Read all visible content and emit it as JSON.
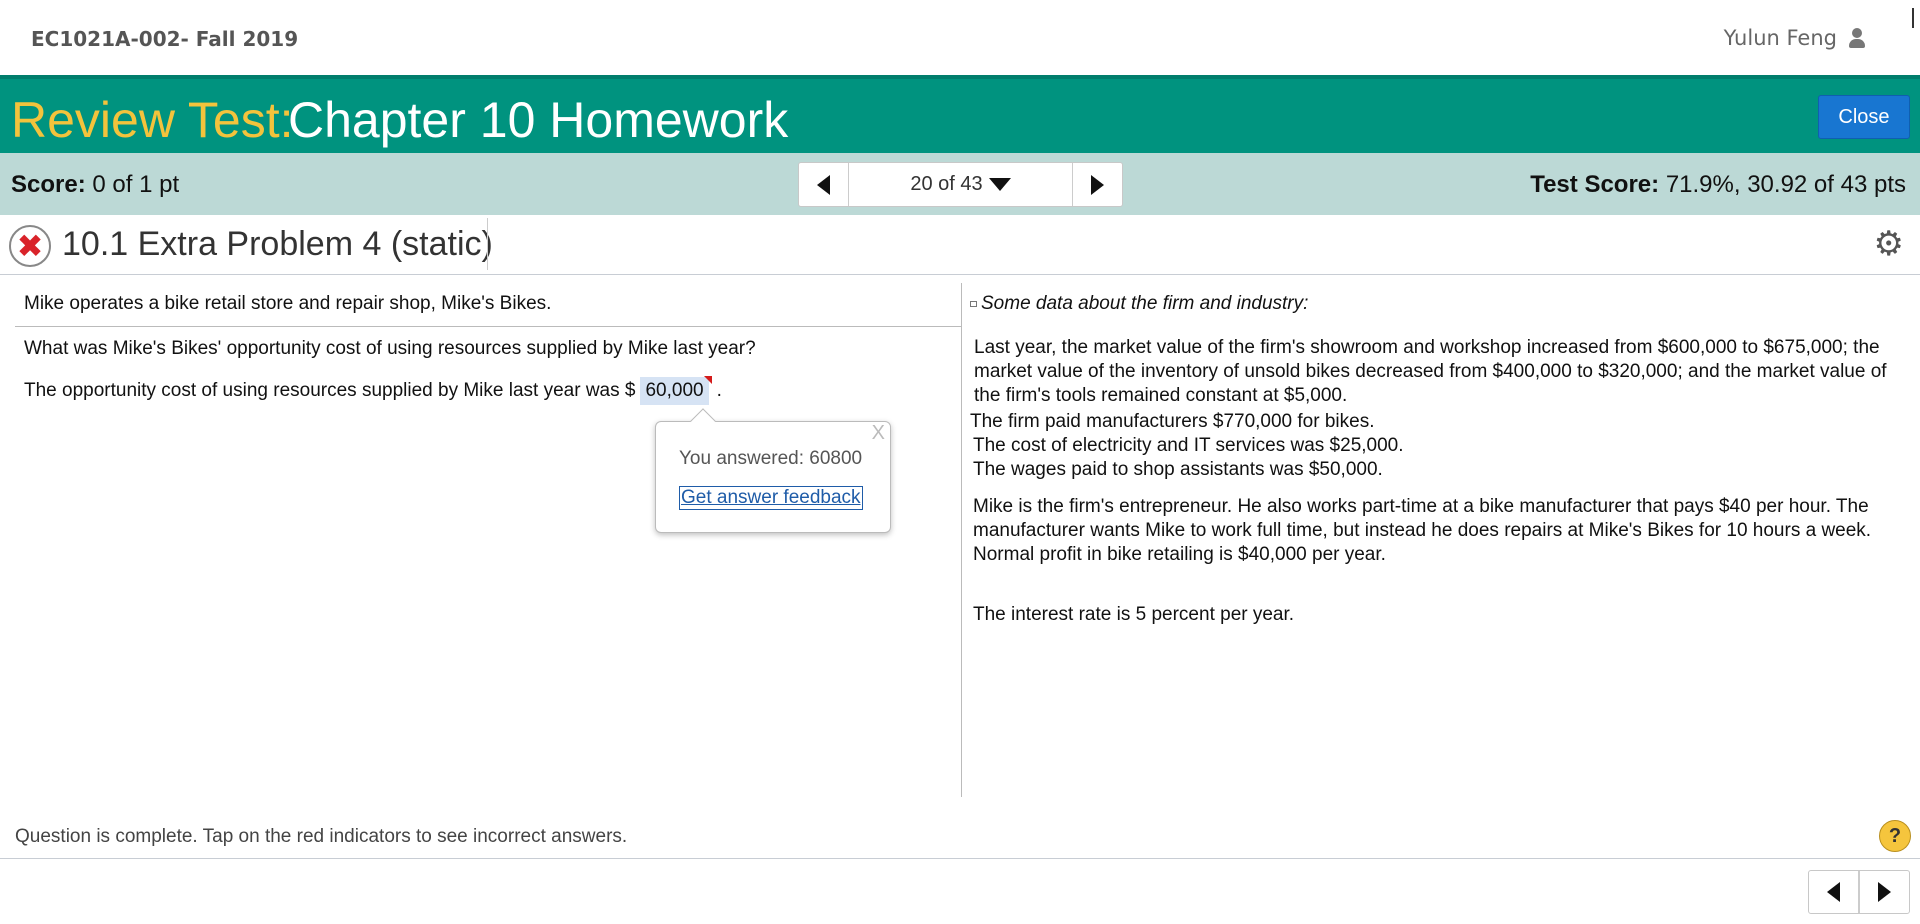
{
  "top": {
    "course": "EC1021A-002- Fall 2019",
    "user_name": "Yulun Feng"
  },
  "header": {
    "title_prefix": "Review Test:",
    "title_main": "Chapter 10 Homework",
    "close_label": "Close"
  },
  "scorebar": {
    "score_label": "Score:",
    "score_value": "0 of 1 pt",
    "pager_text": "20 of 43",
    "test_score_label": "Test Score:",
    "test_score_value": "71.9%, 30.92 of 43 pts"
  },
  "question": {
    "title": "10.1 Extra Problem 4 (static)",
    "intro": "Mike operates a bike retail store and repair shop, Mike's Bikes.",
    "prompt": "What was Mike's Bikes' opportunity cost of using resources supplied by Mike last year?",
    "answer_prefix": "The opportunity cost of using resources supplied by Mike last year was $",
    "answer_value": "60,000",
    "answer_suffix": "."
  },
  "popup": {
    "close_label": "X",
    "answered_text": "You answered: 60800",
    "feedback_link": "Get answer feedback"
  },
  "data_panel": {
    "heading": "Some data about the firm and industry:",
    "para1": "Last year, the market value of the firm's showroom and workshop increased from $600,000 to $675,000; the market value of the inventory of unsold bikes decreased from $400,000 to $320,000; and the market value of the firm's tools remained constant at $5,000.",
    "line_manufacturers": "The firm paid manufacturers $770,000 for bikes.",
    "line_electricity": "The cost of electricity and IT services was $25,000.",
    "line_wages": "The wages paid to shop assistants was $50,000.",
    "para_entrepreneur": "Mike is the firm's entrepreneur. He also works part-time at a bike manufacturer that pays $40 per hour. The manufacturer wants Mike to work full time, but instead he does repairs at Mike's Bikes for 10 hours a week. Normal profit in bike retailing is $40,000 per year.",
    "line_interest": "The interest rate is 5 percent per year."
  },
  "footer": {
    "status": "Question is complete. Tap on the red indicators to see incorrect answers.",
    "help_label": "?"
  },
  "colors": {
    "title_band": "#00937f",
    "title_prefix": "#f3c33c",
    "score_band": "#bcd9d6",
    "close_button": "#1876d1",
    "incorrect_red": "#d9232a"
  }
}
